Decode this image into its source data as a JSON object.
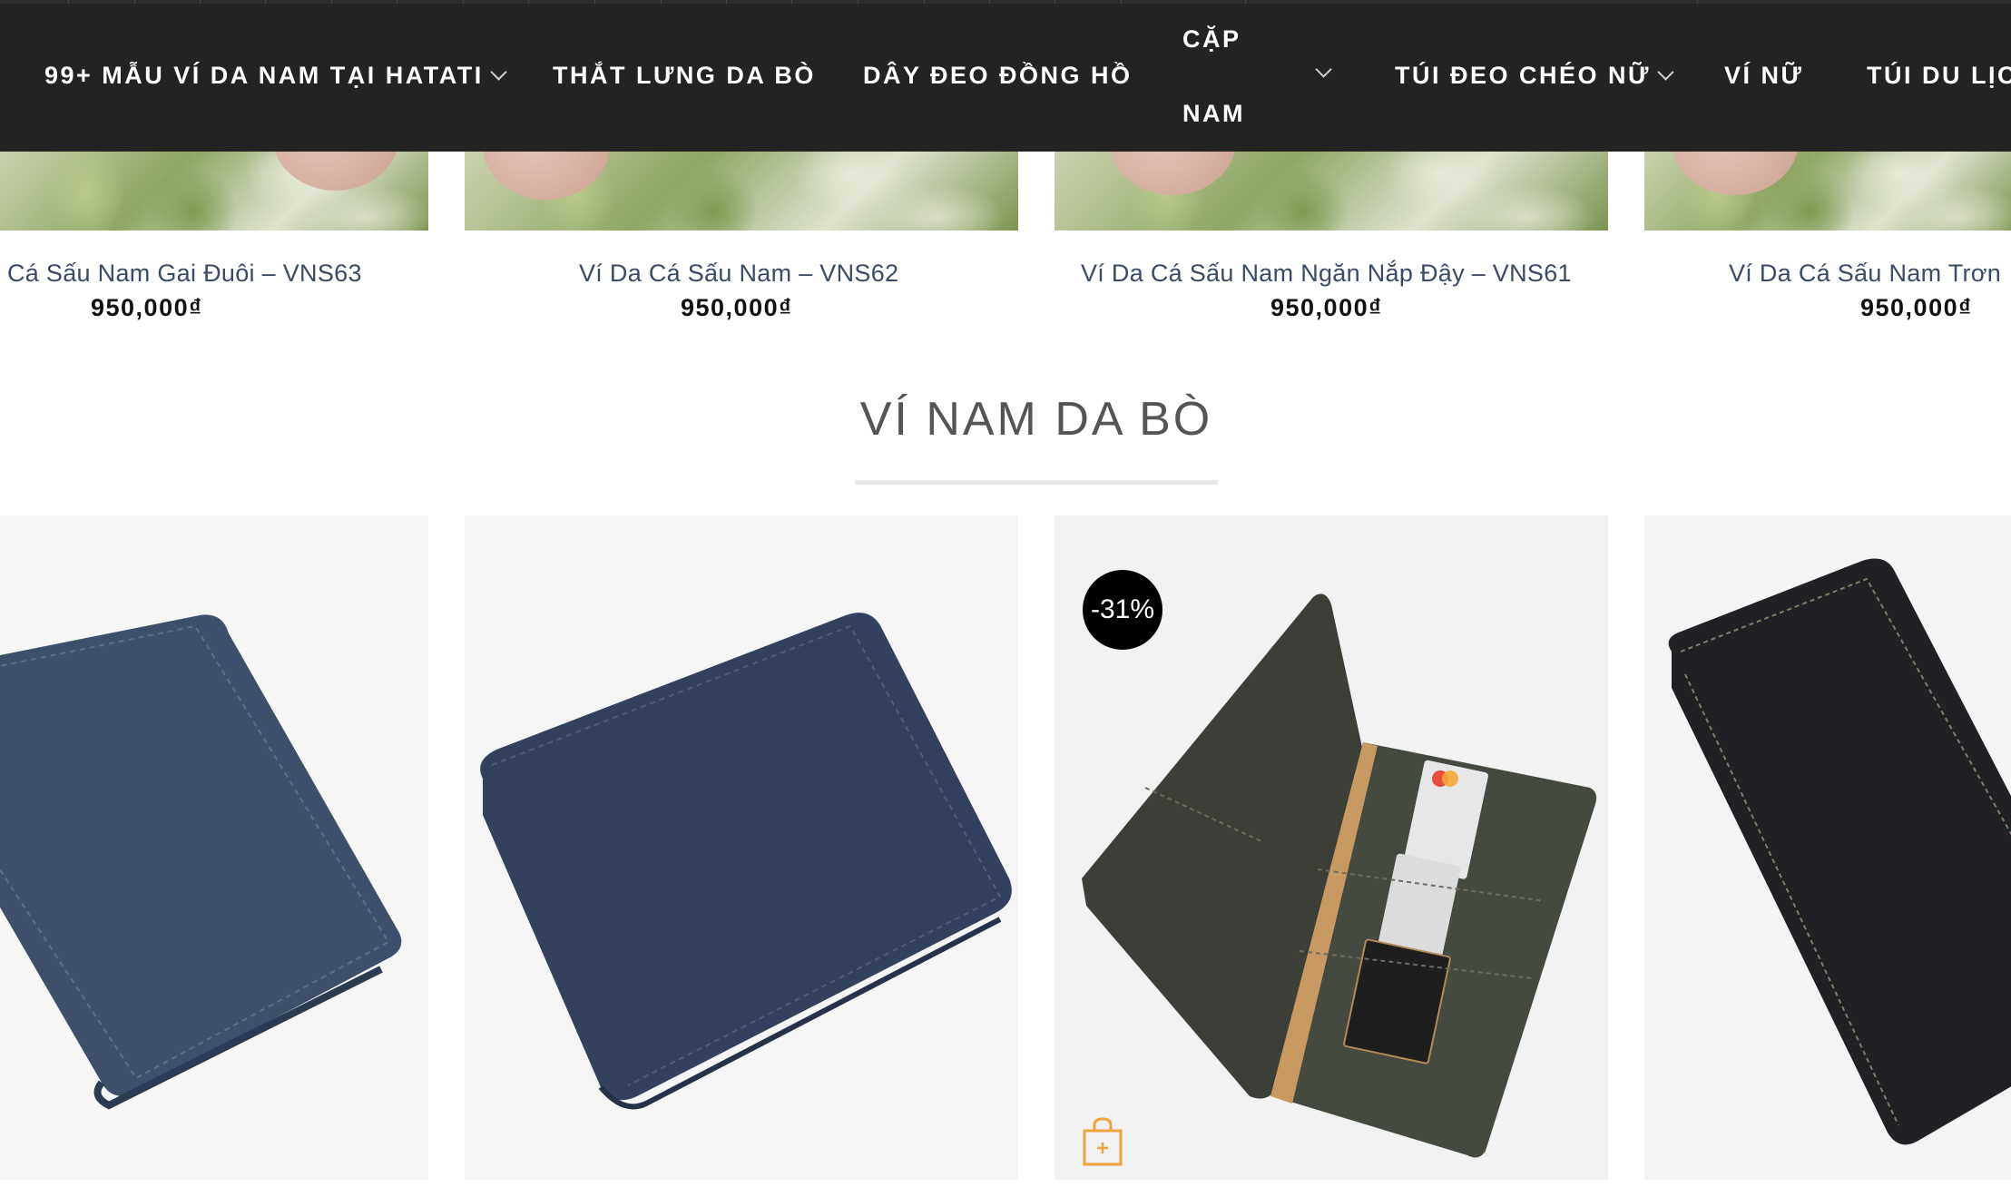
{
  "nav": {
    "items": [
      {
        "label": "99+ MẪU VÍ DA NAM TẠI HATATI",
        "dropdown": true
      },
      {
        "label": "THẮT LƯNG DA BÒ",
        "dropdown": false
      },
      {
        "label": "DÂY ĐEO ĐỒNG HỒ",
        "dropdown": false
      },
      {
        "label_line1": "CẶP",
        "label_line2": "NAM",
        "dropdown": true
      },
      {
        "label": "TÚI ĐEO CHÉO NỮ",
        "dropdown": true
      },
      {
        "label": "VÍ NỮ",
        "dropdown": false
      },
      {
        "label": "TÚI DU LỊCH",
        "dropdown": false
      }
    ]
  },
  "top_products": [
    {
      "name": "Cá Sấu Nam Gai Đuôi – VNS63",
      "price": "950,000₫"
    },
    {
      "name": "Ví Da Cá Sấu Nam – VNS62",
      "price": "950,000₫"
    },
    {
      "name": "Ví Da Cá Sấu Nam Ngăn Nắp Đậy – VNS61",
      "price": "950,000₫"
    },
    {
      "name": "Ví Da Cá Sấu Nam Trơn",
      "price": "950,000₫"
    }
  ],
  "section": {
    "title": "VÍ NAM DA BÒ"
  },
  "bottom_products": [
    {
      "color": "#3d4f6b"
    },
    {
      "color": "#33415e"
    },
    {
      "color": "#3b3f37",
      "badge": "-31%"
    },
    {
      "color": "#1f2124"
    }
  ],
  "colors": {
    "nav_bg": "#232323",
    "badge_bg": "#000000",
    "cart_icon": "#f0a23c"
  },
  "icons": {
    "dropdown": "chevron-down-icon",
    "add_to_cart": "shopping-bag-plus-icon"
  }
}
